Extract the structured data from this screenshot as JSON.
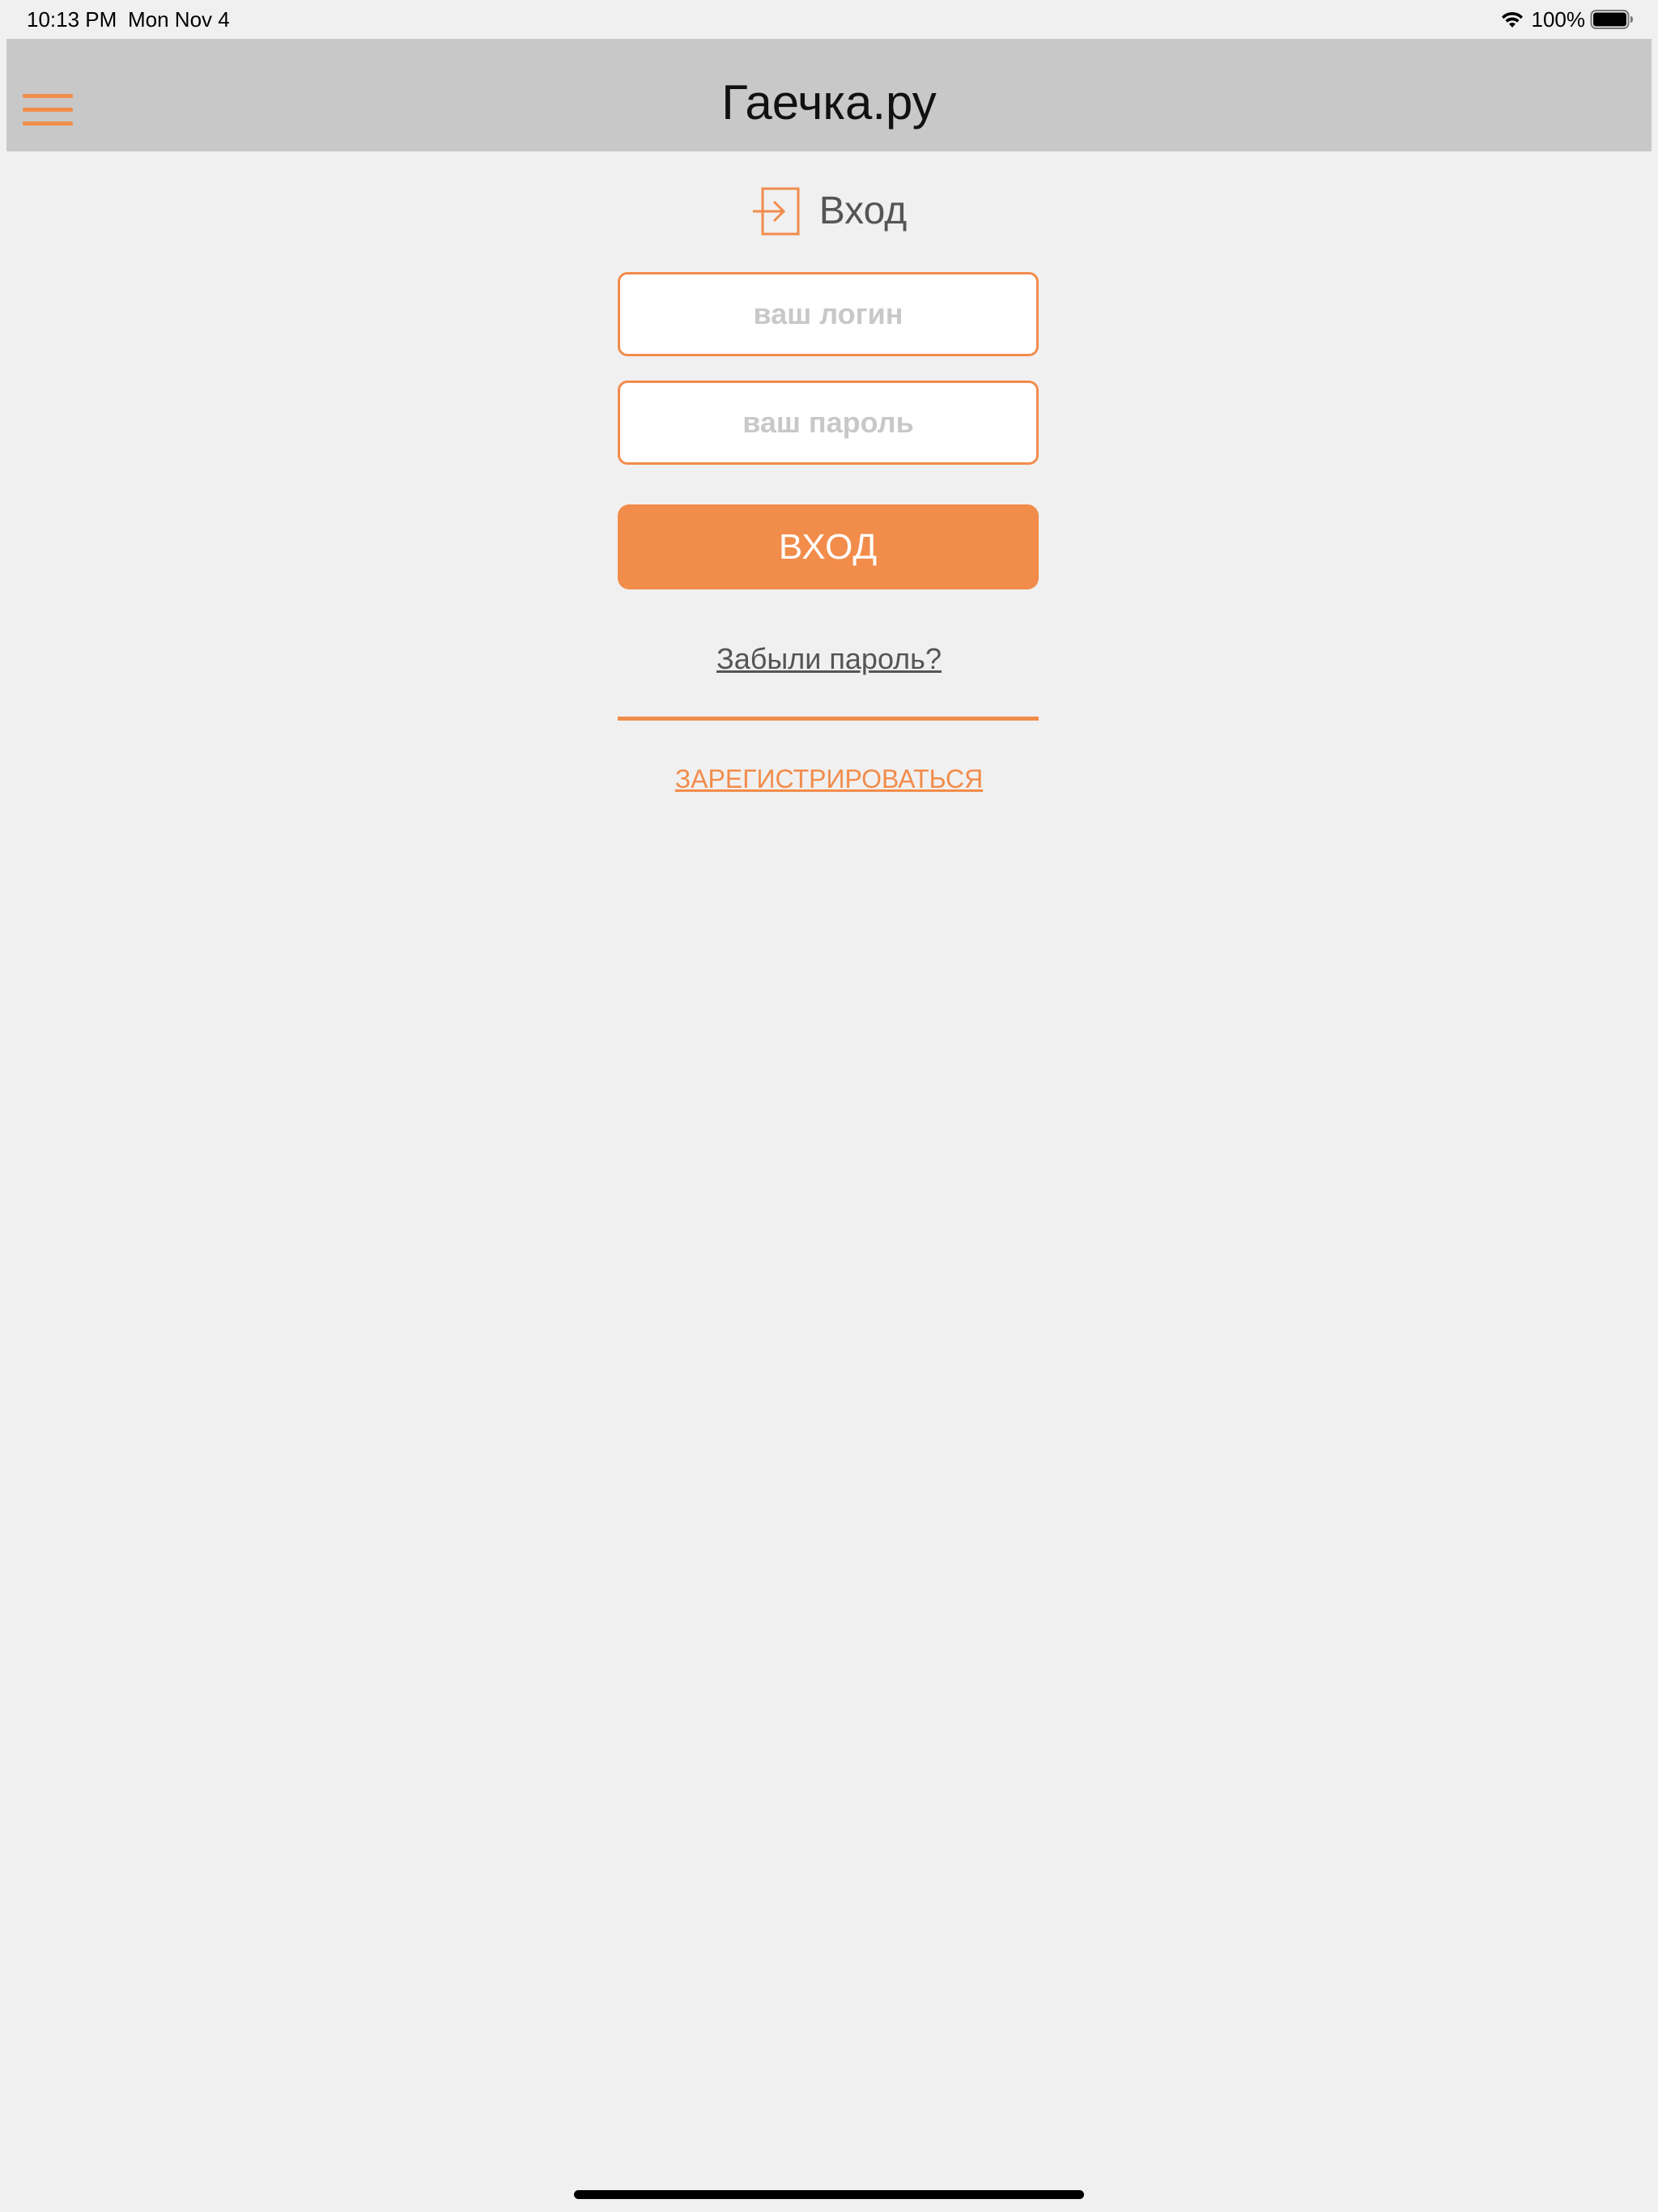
{
  "status_bar": {
    "time": "10:13 PM",
    "date": "Mon Nov 4",
    "battery_percent": "100%",
    "icons": [
      "wifi-icon",
      "battery-icon"
    ]
  },
  "nav": {
    "title": "Гаечка.ру",
    "menu_icon": "hamburger-menu-icon"
  },
  "login": {
    "heading": "Вход",
    "heading_icon": "sign-in-icon",
    "login_placeholder": "ваш логин",
    "password_placeholder": "ваш пароль",
    "submit_label": "ВХОД",
    "forgot_label": "Забыли пароль?",
    "register_label": "ЗАРЕГИСТРИРОВАТЬСЯ"
  },
  "colors": {
    "accent": "#f28c4b",
    "nav_background": "#c8c8c8",
    "page_background": "#f0f0f0"
  }
}
